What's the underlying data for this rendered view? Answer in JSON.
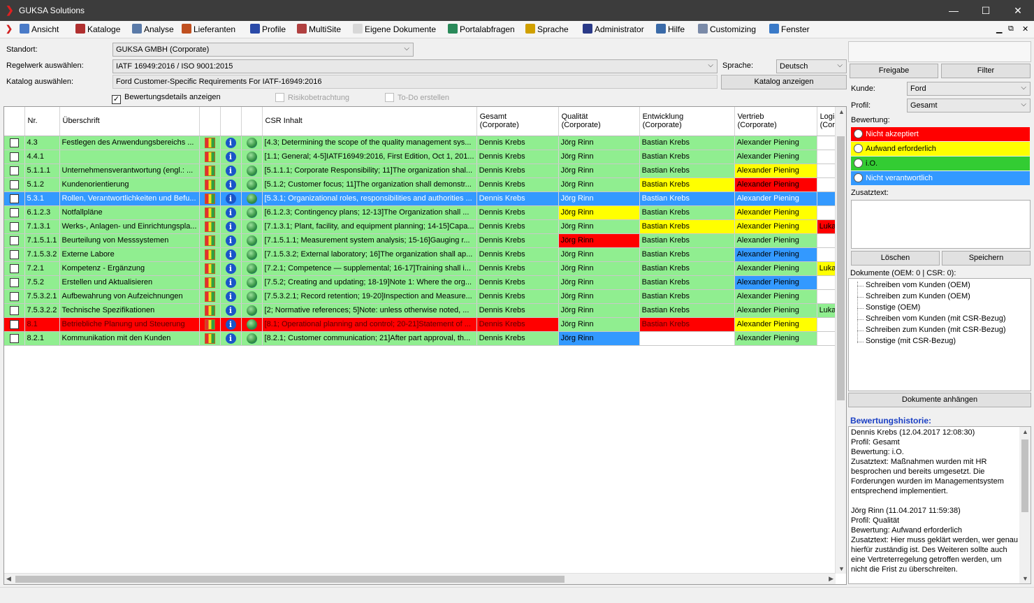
{
  "window": {
    "title": "GUKSA Solutions",
    "minimize": "—",
    "maximize": "☐",
    "close": "✕"
  },
  "menu": [
    {
      "label": "Ansicht",
      "icon": "magnifier-icon",
      "color": "#4a7bc8"
    },
    {
      "label": "Kataloge",
      "icon": "books-icon",
      "color": "#b03030"
    },
    {
      "label": "Analyse",
      "icon": "analysis-icon",
      "color": "#5a7aa8"
    },
    {
      "label": "Lieferanten",
      "icon": "suppliers-icon",
      "color": "#c05020"
    },
    {
      "label": "Profile",
      "icon": "profile-icon",
      "color": "#2a4aa8"
    },
    {
      "label": "MultiSite",
      "icon": "multisite-icon",
      "color": "#b04040"
    },
    {
      "label": "Eigene Dokumente",
      "icon": "documents-icon",
      "color": "#d8d8d8"
    },
    {
      "label": "Portalabfragen",
      "icon": "globe-icon",
      "color": "#2a8a5a"
    },
    {
      "label": "Sprache",
      "icon": "german-flag-icon",
      "color": "#d0a000"
    },
    {
      "label": "Administrator",
      "icon": "admin-icon",
      "color": "#2a3a88"
    },
    {
      "label": "Hilfe",
      "icon": "help-icon",
      "color": "#3a6aa8"
    },
    {
      "label": "Customizing",
      "icon": "gear-icon",
      "color": "#7a8aa8"
    },
    {
      "label": "Fenster",
      "icon": "window-icon",
      "color": "#3a7ac8"
    }
  ],
  "form": {
    "standort_label": "Standort:",
    "standort_value": "GUKSA GMBH (Corporate)",
    "regelwerk_label": "Regelwerk auswählen:",
    "regelwerk_value": "IATF 16949:2016 / ISO 9001:2015",
    "katalog_label": "Katalog auswählen:",
    "katalog_value": "Ford Customer-Specific Requirements For IATF-16949:2016",
    "sprache_label": "Sprache:",
    "sprache_value": "Deutsch",
    "katalog_button": "Katalog anzeigen",
    "chk_bewertung": "Bewertungsdetails anzeigen",
    "chk_risiko": "Risikobetrachtung",
    "chk_todo": "To-Do erstellen"
  },
  "table": {
    "headers": {
      "nr": "Nr.",
      "ueberschrift": "Überschrift",
      "csr": "CSR Inhalt",
      "gesamt_1": "Gesamt",
      "gesamt_2": "(Corporate)",
      "qualitaet_1": "Qualität",
      "qualitaet_2": "(Corporate)",
      "entwicklung_1": "Entwicklung",
      "entwicklung_2": "(Corporate)",
      "vertrieb_1": "Vertrieb",
      "vertrieb_2": "(Corporate)",
      "logis_1": "Logis",
      "logis_2": "(Corp"
    },
    "rows": [
      {
        "nr": "4.3",
        "title": "Festlegen des Anwendungsbereichs ...",
        "csr": "[4.3; Determining the scope of the quality management sys...",
        "g": "Dennis Krebs",
        "q": "Jörg Rinn",
        "e": "Bastian Krebs",
        "v": "Alexander Piening",
        "l": "",
        "cg": "green",
        "cq": "green",
        "ce": "green",
        "cv": "green",
        "cl": "white",
        "row": "green"
      },
      {
        "nr": "4.4.1",
        "title": "",
        "csr": "[1.1; General; 4-5]IATF16949:2016, First Edition, Oct 1, 201...",
        "g": "Dennis Krebs",
        "q": "Jörg Rinn",
        "e": "Bastian Krebs",
        "v": "Alexander Piening",
        "l": "",
        "cg": "green",
        "cq": "green",
        "ce": "green",
        "cv": "green",
        "cl": "white",
        "row": "green"
      },
      {
        "nr": "5.1.1.1",
        "title": "Unternehmensverantwortung (engl.: ...",
        "csr": "[5.1.1.1; Corporate Responsibility; 11]The organization shal...",
        "g": "Dennis Krebs",
        "q": "Jörg Rinn",
        "e": "Bastian Krebs",
        "v": "Alexander Piening",
        "l": "",
        "cg": "green",
        "cq": "green",
        "ce": "green",
        "cv": "yellow",
        "cl": "white",
        "row": "green"
      },
      {
        "nr": "5.1.2",
        "title": "Kundenorientierung",
        "csr": "[5.1.2; Customer focus; 11]The organization shall demonstr...",
        "g": "Dennis Krebs",
        "q": "Jörg Rinn",
        "e": "Bastian Krebs",
        "v": "Alexander Piening",
        "l": "",
        "cg": "green",
        "cq": "green",
        "ce": "yellow",
        "cv": "red",
        "cl": "white",
        "row": "green"
      },
      {
        "nr": "5.3.1",
        "title": "Rollen, Verantwortlichkeiten und Befu...",
        "csr": "[5.3.1; Organizational roles, responsibilities and authorities ...",
        "g": "Dennis Krebs",
        "q": "Jörg Rinn",
        "e": "Bastian Krebs",
        "v": "Alexander Piening",
        "l": "",
        "cg": "green",
        "cq": "yellow",
        "ce": "blue",
        "cv": "yellow",
        "cl": "blue",
        "row": "selected"
      },
      {
        "nr": "6.1.2.3",
        "title": "Notfallpläne",
        "csr": "[6.1.2.3; Contingency plans; 12-13]The Organization shall ...",
        "g": "Dennis Krebs",
        "q": "Jörg Rinn",
        "e": "Bastian Krebs",
        "v": "Alexander Piening",
        "l": "",
        "cg": "green",
        "cq": "yellow",
        "ce": "green",
        "cv": "yellow",
        "cl": "white",
        "row": "green"
      },
      {
        "nr": "7.1.3.1",
        "title": "Werks-, Anlagen- und Einrichtungspla...",
        "csr": "[7.1.3.1; Plant, facility, and equipment planning; 14-15]Capa...",
        "g": "Dennis Krebs",
        "q": "Jörg Rinn",
        "e": "Bastian Krebs",
        "v": "Alexander Piening",
        "l": "Lukas",
        "cg": "green",
        "cq": "green",
        "ce": "yellow",
        "cv": "yellow",
        "cl": "red",
        "row": "green"
      },
      {
        "nr": "7.1.5.1.1",
        "title": "Beurteilung von Messsystemen",
        "csr": "[7.1.5.1.1; Measurement system analysis; 15-16]Gauging r...",
        "g": "Dennis Krebs",
        "q": "Jörg Rinn",
        "e": "Bastian Krebs",
        "v": "Alexander Piening",
        "l": "",
        "cg": "green",
        "cq": "red",
        "ce": "green",
        "cv": "green",
        "cl": "white",
        "row": "green"
      },
      {
        "nr": "7.1.5.3.2",
        "title": "Externe Labore",
        "csr": "[7.1.5.3.2; External laboratory; 16]The organization shall ap...",
        "g": "Dennis Krebs",
        "q": "Jörg Rinn",
        "e": "Bastian Krebs",
        "v": "Alexander Piening",
        "l": "",
        "cg": "green",
        "cq": "green",
        "ce": "green",
        "cv": "blue",
        "cl": "white",
        "row": "green"
      },
      {
        "nr": "7.2.1",
        "title": "Kompetenz - Ergänzung",
        "csr": "[7.2.1; Competence — supplemental; 16-17]Training shall i...",
        "g": "Dennis Krebs",
        "q": "Jörg Rinn",
        "e": "Bastian Krebs",
        "v": "Alexander Piening",
        "l": "Lukas",
        "cg": "green",
        "cq": "green",
        "ce": "green",
        "cv": "green",
        "cl": "yellow",
        "row": "green"
      },
      {
        "nr": "7.5.2",
        "title": "Erstellen und Aktualisieren",
        "csr": "[7.5.2; Creating and updating; 18-19]Note 1: Where the org...",
        "g": "Dennis Krebs",
        "q": "Jörg Rinn",
        "e": "Bastian Krebs",
        "v": "Alexander Piening",
        "l": "",
        "cg": "green",
        "cq": "green",
        "ce": "green",
        "cv": "blue",
        "cl": "white",
        "row": "green"
      },
      {
        "nr": "7.5.3.2.1",
        "title": "Aufbewahrung von Aufzeichnungen",
        "csr": "[7.5.3.2.1; Record retention; 19-20]Inspection and Measure...",
        "g": "Dennis Krebs",
        "q": "Jörg Rinn",
        "e": "Bastian Krebs",
        "v": "Alexander Piening",
        "l": "",
        "cg": "green",
        "cq": "green",
        "ce": "green",
        "cv": "green",
        "cl": "white",
        "row": "green"
      },
      {
        "nr": "7.5.3.2.2",
        "title": "Technische Spezifikationen",
        "csr": "[2; Normative references; 5]Note: unless otherwise noted, ...",
        "g": "Dennis Krebs",
        "q": "Jörg Rinn",
        "e": "Bastian Krebs",
        "v": "Alexander Piening",
        "l": "Lukas",
        "cg": "green",
        "cq": "green",
        "ce": "green",
        "cv": "green",
        "cl": "green",
        "row": "green"
      },
      {
        "nr": "8.1",
        "title": "Betriebliche Planung und Steuerung",
        "csr": "[8.1; Operational planning and control; 20-21]Statement of ...",
        "g": "Dennis Krebs",
        "q": "Jörg Rinn",
        "e": "Bastian Krebs",
        "v": "Alexander Piening",
        "l": "",
        "cg": "red",
        "cq": "green",
        "ce": "red",
        "cv": "yellow",
        "cl": "white",
        "row": "red"
      },
      {
        "nr": "8.2.1",
        "title": "Kommunikation mit den Kunden",
        "csr": "[8.2.1; Customer communication; 21]After part approval, th...",
        "g": "Dennis Krebs",
        "q": "Jörg Rinn",
        "e": "",
        "v": "Alexander Piening",
        "l": "",
        "cg": "green",
        "cq": "blue",
        "ce": "white",
        "cv": "green",
        "cl": "white",
        "row": "green"
      }
    ]
  },
  "colors": {
    "green": "#90ee90",
    "yellow": "#ffff00",
    "red": "#ff0000",
    "blue": "#3399ff",
    "white": "#ffffff"
  },
  "right": {
    "freigabe": "Freigabe",
    "filter": "Filter",
    "kunde_label": "Kunde:",
    "kunde_value": "Ford",
    "profil_label": "Profil:",
    "profil_value": "Gesamt",
    "bewertung_label": "Bewertung:",
    "ratings": [
      {
        "label": "Nicht akzeptiert",
        "color": "#ff0000"
      },
      {
        "label": "Aufwand erforderlich",
        "color": "#ffff00"
      },
      {
        "label": "i.O.",
        "color": "#33cc33"
      },
      {
        "label": "Nicht verantwortlich",
        "color": "#3399ff"
      }
    ],
    "zusatztext_label": "Zusatztext:",
    "loeschen": "Löschen",
    "speichern": "Speichern",
    "dokumente_label": "Dokumente (OEM: 0  |  CSR: 0):",
    "docs": [
      "Schreiben vom Kunden (OEM)",
      "Schreiben zum Kunden (OEM)",
      "Sonstige (OEM)",
      "Schreiben vom Kunden (mit CSR-Bezug)",
      "Schreiben zum Kunden (mit CSR-Bezug)",
      "Sonstige (mit CSR-Bezug)"
    ],
    "dokumente_button": "Dokumente anhängen",
    "historie_title": "Bewertungshistorie:",
    "historie_lines": [
      "Dennis Krebs (12.04.2017 12:08:30)",
      "Profil: Gesamt",
      "Bewertung: i.O.",
      "Zusatztext: Maßnahmen wurden mit HR",
      "besprochen und bereits umgesetzt. Die",
      "Forderungen wurden im Managementsystem",
      "entsprechend implementiert.",
      "",
      "Jörg Rinn (11.04.2017 11:59:38)",
      "Profil: Qualität",
      "Bewertung: Aufwand erforderlich",
      "Zusatztext: Hier muss geklärt werden, wer genau",
      "hierfür zuständig ist. Des Weiteren sollte auch",
      "eine Vertreterregelung getroffen werden, um",
      "nicht die Frist zu überschreiten."
    ]
  }
}
